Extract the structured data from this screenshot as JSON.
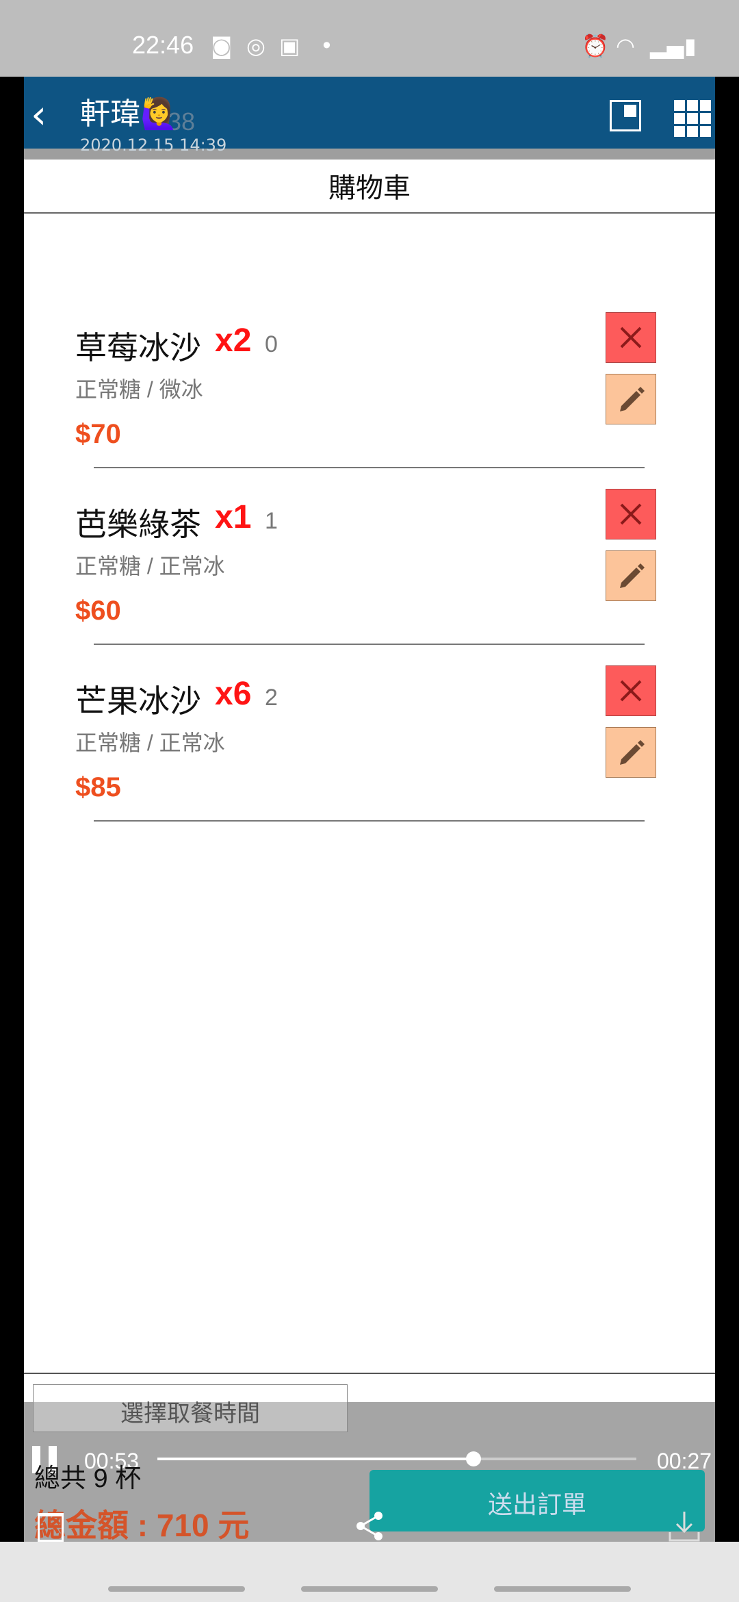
{
  "status": {
    "time": "22:46"
  },
  "header": {
    "sender": "軒瑋🙋‍♀️",
    "date": "2020.12.15 14:39",
    "ghost_time": "1:38"
  },
  "page": {
    "title": "購物車"
  },
  "items": [
    {
      "name": "草莓冰沙",
      "qty": "x2",
      "index": "0",
      "options": "正常糖 / 微冰",
      "price": "$70"
    },
    {
      "name": "芭樂綠茶",
      "qty": "x1",
      "index": "1",
      "options": "正常糖 / 正常冰",
      "price": "$60"
    },
    {
      "name": "芒果冰沙",
      "qty": "x6",
      "index": "2",
      "options": "正常糖 / 正常冰",
      "price": "$85"
    }
  ],
  "footer": {
    "pick_time_label": "選擇取餐時間",
    "total_cups": "總共 9 杯",
    "total_amount": "總金額 : 710 元",
    "submit_label": "送出訂單"
  },
  "player": {
    "current_time": "00:53",
    "duration": "00:27",
    "progress": 0.66
  },
  "colors": {
    "header_bg": "#0e5483",
    "qty_red": "#ff1414",
    "price_orange": "#ee4f1f",
    "delete_bg": "#fd5b5b",
    "edit_bg": "#fcc49a",
    "submit_bg": "#16a3a1"
  }
}
